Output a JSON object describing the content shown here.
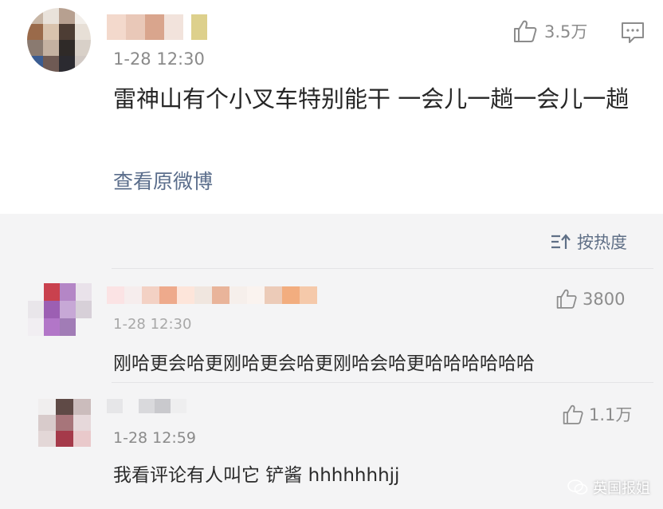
{
  "post": {
    "time": "1-28 12:30",
    "likes": "3.5万",
    "text": "雷神山有个小叉车特别能干 一会儿一趟一会儿一趟",
    "view_original": "查看原微博"
  },
  "sort": {
    "label": "按热度"
  },
  "comments": [
    {
      "time": "1-28 12:30",
      "likes": "3800",
      "text": "刚哈更会哈更刚哈更会哈更刚哈会哈更哈哈哈哈哈哈"
    },
    {
      "time": "1-28 12:59",
      "likes": "1.1万",
      "text": "我看评论有人叫它 铲酱 hhhhhhhjj"
    }
  ],
  "watermark": {
    "text": "英国报姐"
  },
  "colors": {
    "link": "#5a6d8b",
    "meta": "#8a8a8a",
    "background": "#f4f4f5"
  }
}
